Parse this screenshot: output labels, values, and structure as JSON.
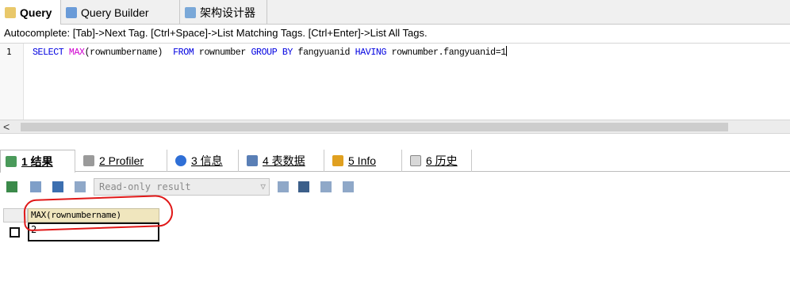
{
  "top_tabs": [
    {
      "label": "Query",
      "icon": "query-icon",
      "active": true
    },
    {
      "label": "Query Builder",
      "icon": "query-builder-icon"
    },
    {
      "label": "架构设计器",
      "icon": "schema-designer-icon"
    }
  ],
  "autocomplete_hint": "Autocomplete: [Tab]->Next Tag. [Ctrl+Space]->List Matching Tags. [Ctrl+Enter]->List All Tags.",
  "editor": {
    "line_number": "1",
    "code": {
      "select": "SELECT",
      "max": "MAX",
      "arg": "(rownumbername)",
      "from": "FROM",
      "table": "rownumber",
      "group_by": "GROUP BY",
      "group_col": "fangyuanid",
      "having": "HAVING",
      "condition": "rownumber.fangyuanid=1"
    },
    "scroll_left_glyph": "<"
  },
  "result_tabs": [
    {
      "label": "1 结果",
      "icon": "result-icon",
      "active": true
    },
    {
      "label": "2 Profiler",
      "icon": "profiler-icon"
    },
    {
      "label": "3 信息",
      "icon": "info-icon"
    },
    {
      "label": "4 表数据",
      "icon": "table-data-icon"
    },
    {
      "label": "5 Info",
      "icon": "info-chart-icon"
    },
    {
      "label": "6 历史",
      "icon": "history-icon"
    }
  ],
  "result_toolbar": {
    "mode_select": "Read-only result"
  },
  "grid": {
    "column_header": "MAX(rownumbername)",
    "cell_value": "2"
  },
  "colors": {
    "keyword": "#0000e0",
    "function": "#d000d0",
    "annotation": "#e01818",
    "column_header_bg": "#f0e6be"
  }
}
